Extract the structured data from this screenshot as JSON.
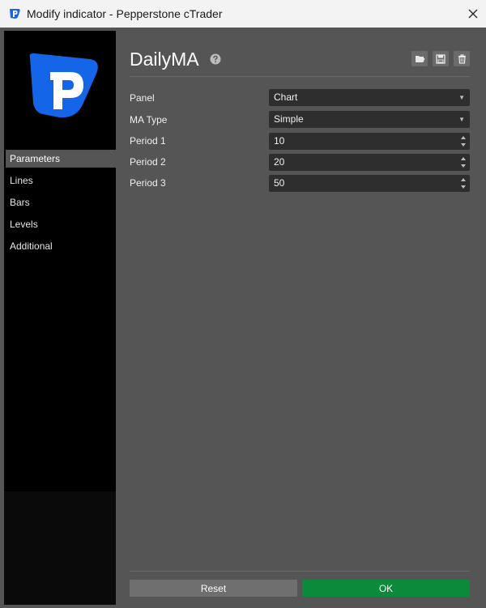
{
  "window": {
    "title": "Modify indicator - Pepperstone cTrader",
    "close_icon": "close-icon"
  },
  "sidebar": {
    "items": [
      {
        "label": "Parameters",
        "active": true
      },
      {
        "label": "Lines",
        "active": false
      },
      {
        "label": "Bars",
        "active": false
      },
      {
        "label": "Levels",
        "active": false
      },
      {
        "label": "Additional",
        "active": false
      }
    ]
  },
  "header": {
    "title": "DailyMA",
    "icons": [
      "help-icon",
      "open-folder-icon",
      "save-icon",
      "delete-icon"
    ]
  },
  "parameters": {
    "panel": {
      "label": "Panel",
      "value": "Chart"
    },
    "ma_type": {
      "label": "MA Type",
      "value": "Simple"
    },
    "period1": {
      "label": "Period 1",
      "value": "10"
    },
    "period2": {
      "label": "Period 2",
      "value": "20"
    },
    "period3": {
      "label": "Period 3",
      "value": "50"
    }
  },
  "footer": {
    "reset_label": "Reset",
    "ok_label": "OK"
  },
  "colors": {
    "brand_blue": "#1565e8",
    "ok_green": "#0b8a3c",
    "panel_bg": "#555555"
  }
}
